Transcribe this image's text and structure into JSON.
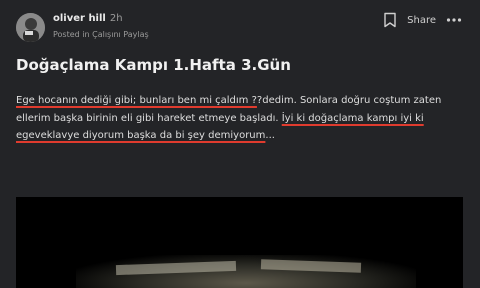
{
  "post": {
    "author": "oliver hill",
    "time": "2h",
    "posted_in": "Posted in Çalışını Paylaş",
    "share_label": "Share",
    "title": "Doğaçlama Kampı 1.Hafta 3.Gün",
    "body": {
      "part1": "Ege hocanın dediği gibi; bunları ben mi çaldım ?",
      "part2": "?dedim. Sonlara doğru coştum zaten ellerim başka birinin eli gibi hareket etmeye başladı. ",
      "part3": "İyi ki doğaçlama kampı iyi ki egeveklavye diyorum başka da bi şey demiyorum",
      "ellipsis": "..."
    }
  },
  "icons": {
    "bookmark": "bookmark-icon",
    "more": "more-horizontal-icon"
  },
  "colors": {
    "background": "#232427",
    "underline": "#e03b2e"
  }
}
